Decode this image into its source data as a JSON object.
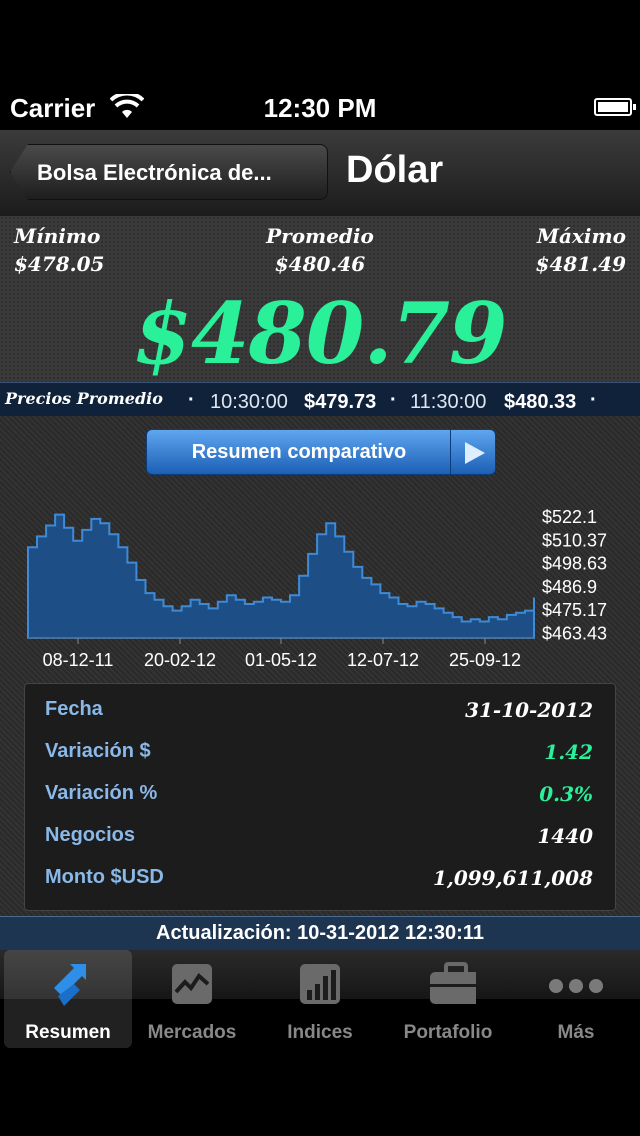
{
  "status": {
    "carrier": "Carrier",
    "time": "12:30 PM"
  },
  "nav": {
    "back_label": "Bolsa Electrónica de...",
    "title": "Dólar"
  },
  "price": {
    "min_label": "Mínimo",
    "min_value": "$478.05",
    "avg_label": "Promedio",
    "avg_value": "$480.46",
    "max_label": "Máximo",
    "max_value": "$481.49",
    "current": "$480.79"
  },
  "ticker": {
    "label": "Precios Promedio",
    "items": [
      {
        "time": "10:30:00",
        "value": "$479.73"
      },
      {
        "time": "11:30:00",
        "value": "$480.33"
      }
    ]
  },
  "summary_button": "Resumen comparativo",
  "chart_data": {
    "type": "area",
    "x_labels": [
      "08-12-11",
      "20-02-12",
      "01-05-12",
      "12-07-12",
      "25-09-12"
    ],
    "y_labels": [
      "$522.1",
      "$510.37",
      "$498.63",
      "$486.9",
      "$475.17",
      "$463.43"
    ],
    "ylim": [
      463.43,
      522.1
    ],
    "values": [
      505,
      510,
      515,
      520,
      514,
      508,
      513,
      518,
      516,
      511,
      505,
      498,
      490,
      484,
      481,
      478,
      476,
      478,
      481,
      479,
      477,
      480,
      483,
      481,
      479,
      480,
      482,
      481,
      480,
      483,
      492,
      502,
      511,
      516,
      510,
      503,
      496,
      491,
      488,
      484,
      482,
      479,
      478,
      480,
      479,
      477,
      475,
      473,
      471,
      472,
      471,
      473,
      472,
      474,
      475,
      476,
      482
    ],
    "color": "#3f8ad6"
  },
  "stats": [
    {
      "key": "Fecha",
      "value": "31-10-2012",
      "color": "#ffffff"
    },
    {
      "key": "Variación $",
      "value": "1.42",
      "color": "#2af09a"
    },
    {
      "key": "Variación %",
      "value": "0.3%",
      "color": "#2af09a"
    },
    {
      "key": "Negocios",
      "value": "1440",
      "color": "#ffffff"
    },
    {
      "key": "Monto $USD",
      "value": "1,099,611,008",
      "color": "#ffffff"
    }
  ],
  "update": "Actualización: 10-31-2012 12:30:11",
  "tabs": [
    {
      "label": "Resumen",
      "icon": "resumen-arrows-icon"
    },
    {
      "label": "Mercados",
      "icon": "chart-line-icon"
    },
    {
      "label": "Indices",
      "icon": "bar-chart-icon"
    },
    {
      "label": "Portafolio",
      "icon": "briefcase-icon"
    },
    {
      "label": "Más",
      "icon": "more-dots-icon"
    }
  ]
}
